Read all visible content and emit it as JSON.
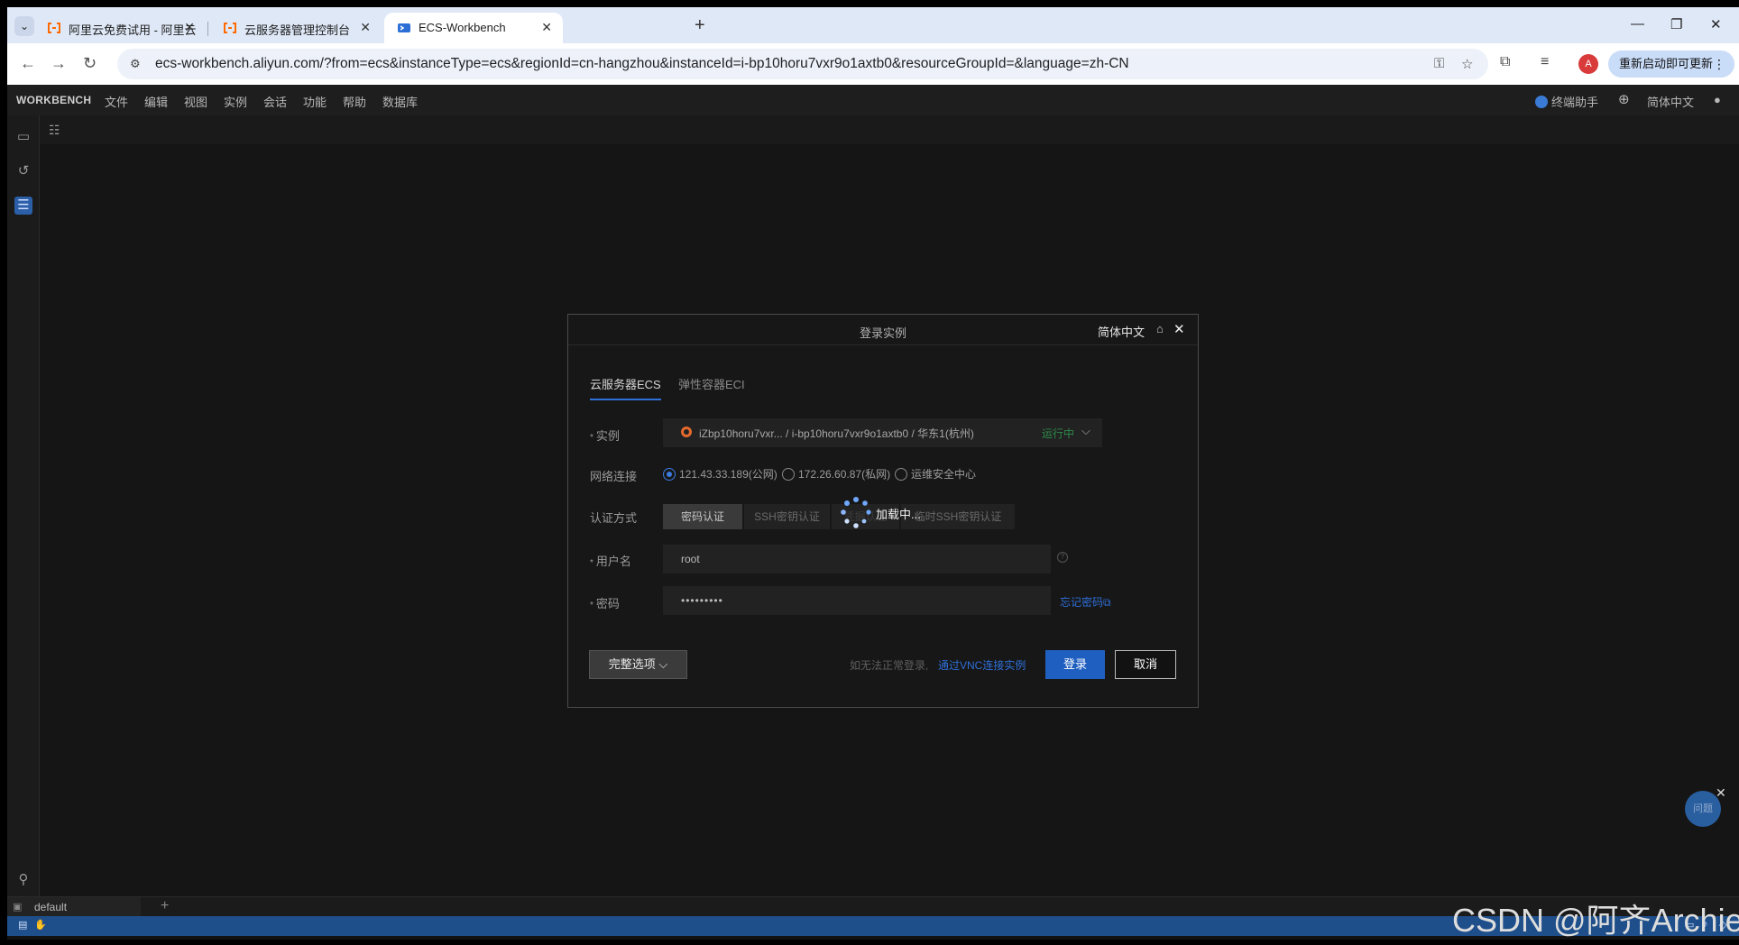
{
  "browser": {
    "tabs": [
      {
        "title": "阿里云免费试用 - 阿里云"
      },
      {
        "title": "云服务器管理控制台"
      },
      {
        "title": "ECS-Workbench"
      }
    ],
    "url": "ecs-workbench.aliyun.com/?from=ecs&instanceType=ecs&regionId=cn-hangzhou&instanceId=i-bp10horu7vxr9o1axtb0&resourceGroupId=&language=zh-CN",
    "profile_initial": "A",
    "update_label": "重新启动即可更新"
  },
  "workbench": {
    "brand": "WORKBENCH",
    "menu": [
      "文件",
      "编辑",
      "视图",
      "实例",
      "会话",
      "功能",
      "帮助",
      "数据库"
    ],
    "assistant_label": "终端助手",
    "language_label": "简体中文"
  },
  "dialog": {
    "title": "登录实例",
    "language": "简体中文",
    "tabs": [
      "云服务器ECS",
      "弹性容器ECI"
    ],
    "instance_label": "实例",
    "instance_value": "iZbp10horu7vxr...  / i-bp10horu7vxr9o1axtb0  / 华东1(杭州)",
    "instance_status": "运行中",
    "network_label": "网络连接",
    "network_options": [
      "121.43.33.189(公网)",
      "172.26.60.87(私网)",
      "运维安全中心"
    ],
    "auth_label": "认证方式",
    "auth_options": [
      "密码认证",
      "SSH密钥认证",
      "凭据认证",
      "临时SSH密钥认证"
    ],
    "loading_text": "加载中...",
    "username_label": "用户名",
    "username_value": "root",
    "password_label": "密码",
    "password_value": "•••••••••",
    "forgot_password": "忘记密码",
    "full_options": "完整选项",
    "hint": "如无法正常登录,",
    "vnc_link": "通过VNC连接实例",
    "login": "登录",
    "cancel": "取消"
  },
  "terminal": {
    "tab_label": "default"
  },
  "floating_assistant_label": "问题",
  "watermark": "CSDN @阿齐Archie",
  "colors": {
    "accent": "#2f6fd8",
    "running_status": "#2d8b4a",
    "statusbar": "#1f4f8a"
  }
}
